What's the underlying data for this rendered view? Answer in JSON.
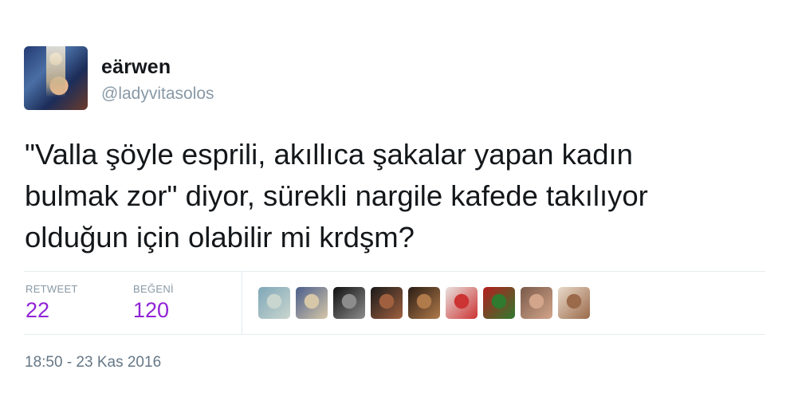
{
  "user": {
    "display_name": "eärwen",
    "handle": "@ladyvitasolos"
  },
  "tweet": {
    "text": "\"Valla şöyle esprili, akıllıca şakalar yapan kadın\nbulmak zor\" diyor, sürekli nargile kafede takılıyor\nolduğun için olabilir mi krdşm?"
  },
  "stats": {
    "retweet_label": "RETWEET",
    "retweet_count": "22",
    "likes_label": "BEĞENİ",
    "likes_count": "120"
  },
  "likers": [
    {
      "icon": "avatar-1",
      "color_a": "#7fa7b8",
      "color_b": "#c9d6cf"
    },
    {
      "icon": "avatar-2",
      "color_a": "#4b5e8c",
      "color_b": "#d6c7a8"
    },
    {
      "icon": "avatar-3",
      "color_a": "#111111",
      "color_b": "#8c8c8c"
    },
    {
      "icon": "avatar-4",
      "color_a": "#1a1a1a",
      "color_b": "#a0603f"
    },
    {
      "icon": "avatar-5",
      "color_a": "#2b1d14",
      "color_b": "#b07a4a"
    },
    {
      "icon": "avatar-6",
      "color_a": "#e8e2de",
      "color_b": "#cc3333"
    },
    {
      "icon": "avatar-7",
      "color_a": "#b51d1d",
      "color_b": "#2f7a2f"
    },
    {
      "icon": "avatar-8",
      "color_a": "#7a5a4a",
      "color_b": "#d3a58a"
    },
    {
      "icon": "avatar-9",
      "color_a": "#e9d9c9",
      "color_b": "#9a6a4a"
    }
  ],
  "timestamp": "18:50 - 23 Kas 2016",
  "colors": {
    "likes_accent": "#9023d6",
    "muted": "#8899a6"
  }
}
